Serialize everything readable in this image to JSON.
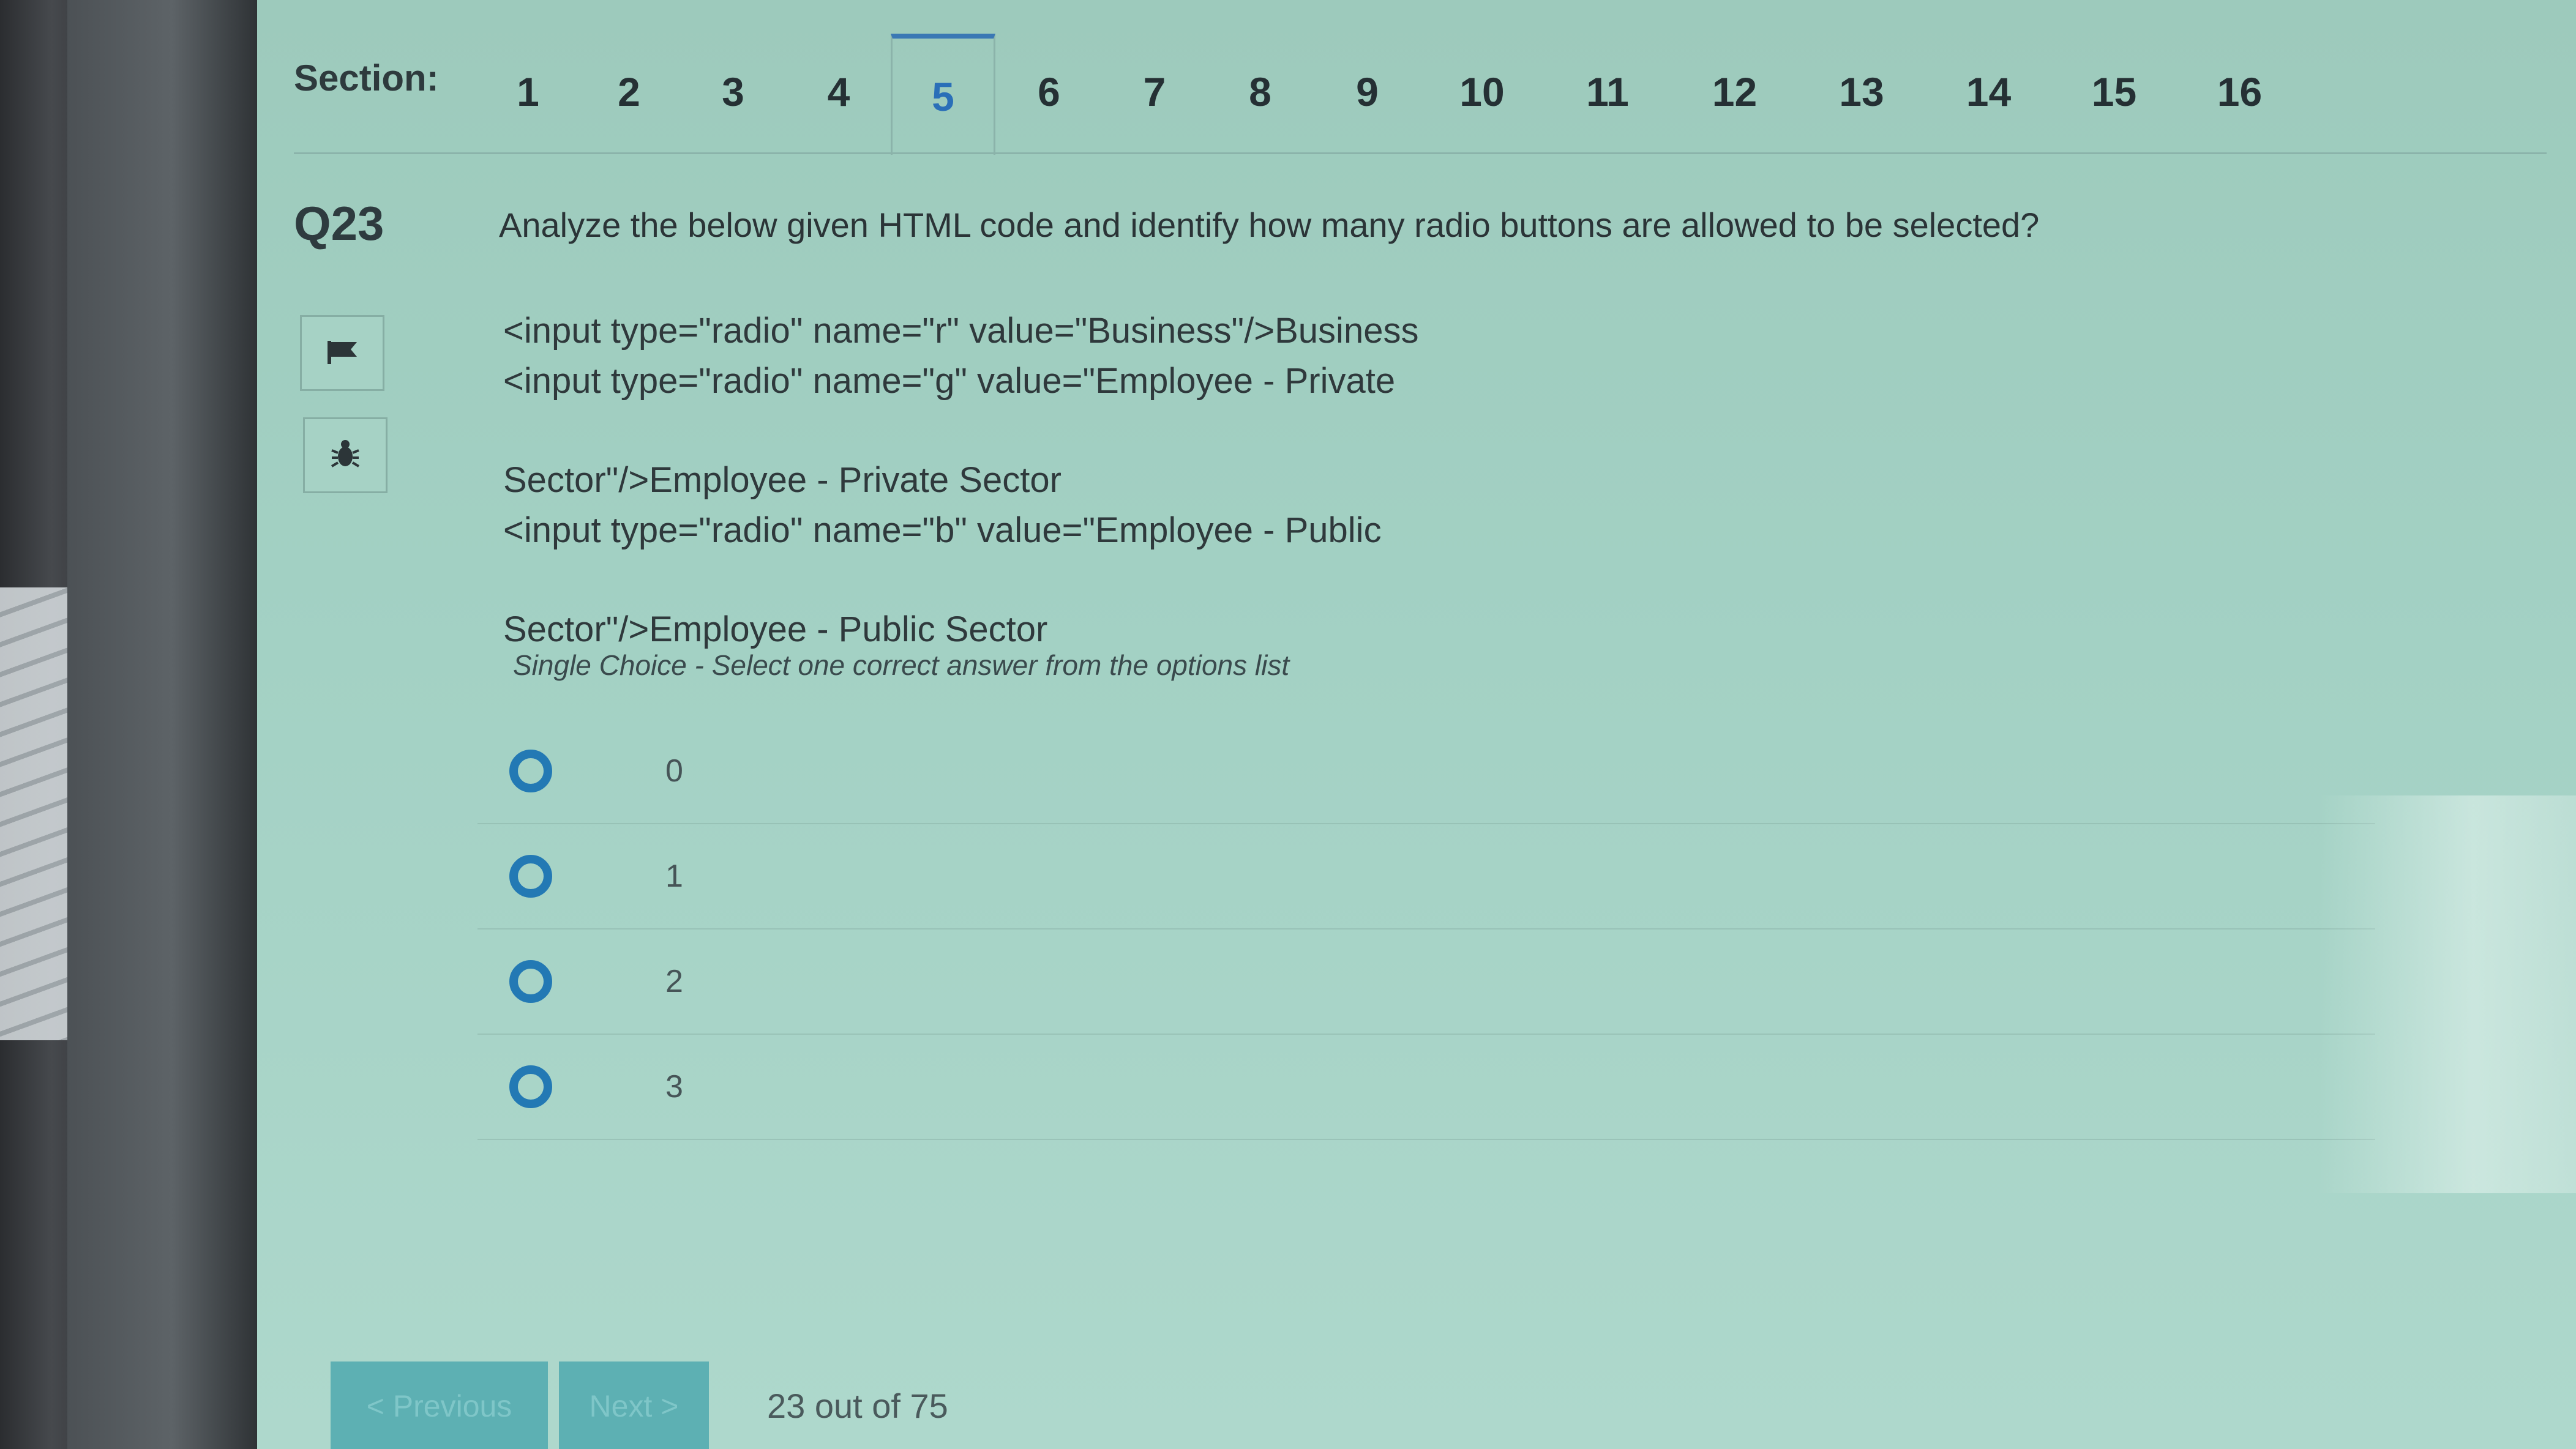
{
  "section_nav": {
    "label": "Section:",
    "tabs": [
      "1",
      "2",
      "3",
      "4",
      "5",
      "6",
      "7",
      "8",
      "9",
      "10",
      "11",
      "12",
      "13",
      "14",
      "15",
      "16"
    ],
    "active_tab": "5"
  },
  "question": {
    "number": "Q23",
    "text": "Analyze the below given HTML code and identify how many radio buttons are allowed to be selected?",
    "code_lines": [
      "<input type=\"radio\" name=\"r\" value=\"Business\"/>Business",
      "<input type=\"radio\" name=\"g\" value=\"Employee - Private",
      "Sector\"/>Employee - Private Sector",
      "<input type=\"radio\" name=\"b\" value=\"Employee - Public",
      "Sector\"/>Employee - Public Sector"
    ],
    "instruction": "Single Choice - Select one correct answer from the options list",
    "options": [
      "0",
      "1",
      "2",
      "3"
    ],
    "icons": [
      "flag-icon",
      "bug-icon"
    ]
  },
  "footer": {
    "previous_label": "< Previous",
    "next_label": "Next >",
    "progress": "23 out of 75"
  },
  "colors": {
    "accent": "#2379b4",
    "active_tab": "#2a6fb8",
    "screen_bg": "#a3d1c4",
    "button_bg": "#5db0b3"
  }
}
